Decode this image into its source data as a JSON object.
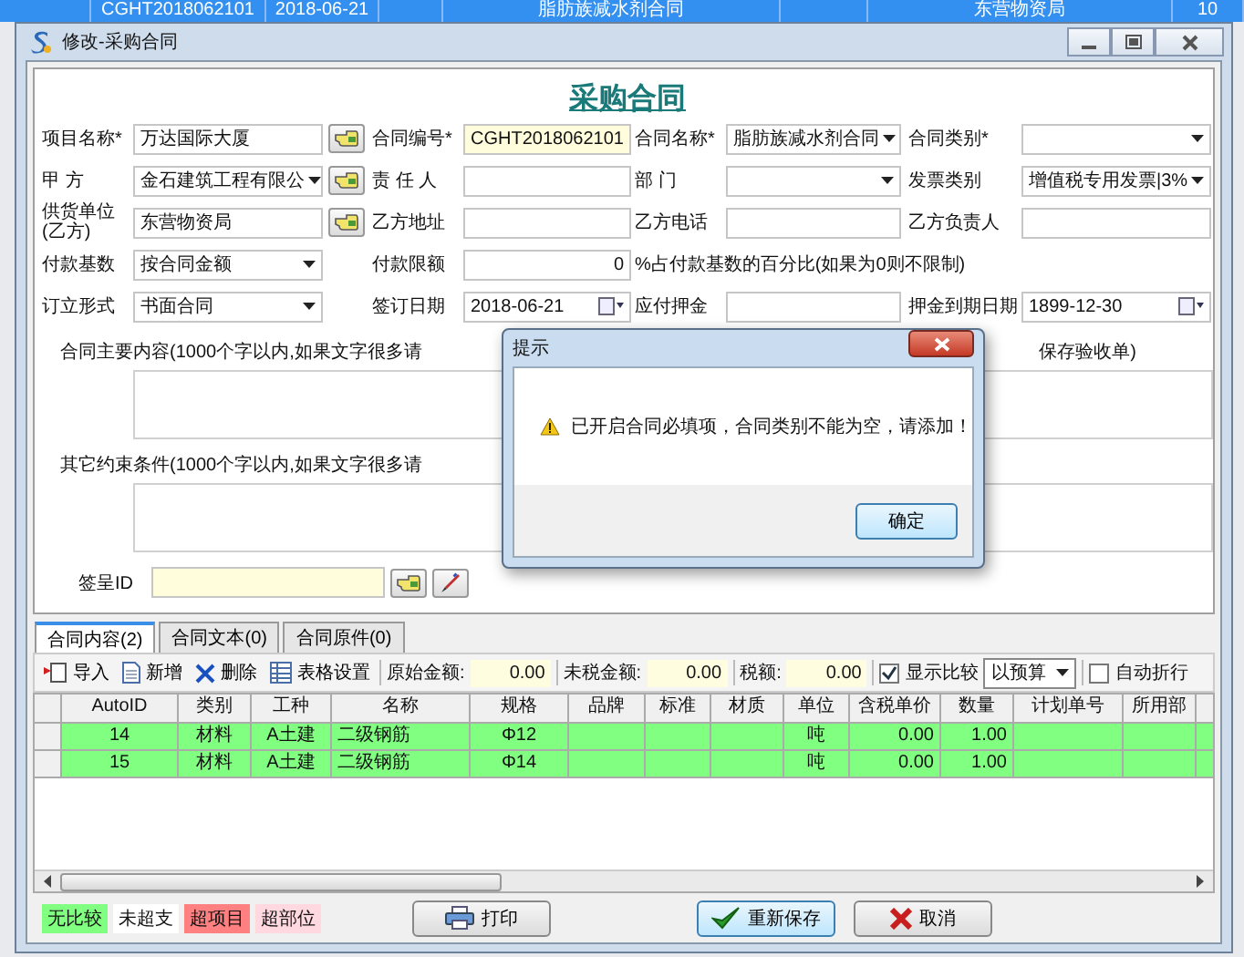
{
  "background_row": {
    "cells": [
      "CGHT2018062101",
      "2018-06-21",
      "脂肪族减水剂合同",
      "东营物资局",
      "10"
    ]
  },
  "window": {
    "title": "修改-采购合同"
  },
  "heading": "采购合同",
  "form": {
    "rows": [
      {
        "fields": [
          {
            "label": "项目名称*",
            "kind": "text",
            "value": "万达国际大厦",
            "readonly": false,
            "lookup": true
          },
          {
            "label": "合同编号*",
            "kind": "text",
            "value": "CGHT2018062101",
            "readonly": true,
            "lookup": false
          },
          {
            "label": "合同名称*",
            "kind": "select",
            "value": "脂肪族减水剂合同",
            "readonly": false,
            "lookup": false
          },
          {
            "label": "合同类别*",
            "kind": "select",
            "readonly": false,
            "lookup": false
          }
        ]
      },
      {
        "fields": [
          {
            "label": "甲 方",
            "kind": "select",
            "value": "金石建筑工程有限公",
            "readonly": false,
            "lookup": true
          },
          {
            "label": "责 任 人",
            "kind": "text",
            "readonly": false,
            "lookup": false
          },
          {
            "label": "部 门",
            "kind": "select",
            "readonly": false,
            "lookup": false
          },
          {
            "label": "发票类别",
            "kind": "select",
            "value": "增值税专用发票|3%",
            "readonly": false,
            "lookup": false
          }
        ]
      },
      {
        "fields": [
          {
            "label": "供货单位(乙方)",
            "kind": "text",
            "value": "东营物资局",
            "readonly": false,
            "lookup": true
          },
          {
            "label": "乙方地址",
            "kind": "text",
            "readonly": false,
            "lookup": false
          },
          {
            "label": "乙方电话",
            "kind": "text",
            "readonly": false,
            "lookup": false
          },
          {
            "label": "乙方负责人",
            "kind": "text",
            "readonly": false,
            "lookup": false
          }
        ]
      },
      {
        "fields": [
          {
            "label": "付款基数",
            "kind": "select",
            "value": "按合同金额",
            "readonly": false,
            "lookup": false
          },
          {
            "label": "付款限额",
            "kind": "number",
            "value": "0",
            "readonly": false,
            "lookup": false,
            "note": "%占付款基数的百分比(如果为0则不限制)"
          }
        ]
      },
      {
        "fields": [
          {
            "label": "订立形式",
            "kind": "select",
            "value": "书面合同",
            "readonly": false,
            "lookup": false
          },
          {
            "label": "签订日期",
            "kind": "date",
            "value": "2018-06-21",
            "readonly": false,
            "lookup": false
          },
          {
            "label": "应付押金",
            "kind": "text",
            "readonly": false,
            "lookup": false
          },
          {
            "label": "押金到期日期",
            "kind": "date",
            "value": "1899-12-30",
            "readonly": false,
            "lookup": false
          }
        ]
      }
    ]
  },
  "content_label": {
    "left": "合同主要内容(1000个字以内,如果文字很多请",
    "right": "保存验收单)"
  },
  "conditions_label": "其它约束条件(1000个字以内,如果文字很多请",
  "sign": {
    "label": "签呈ID",
    "readonly": true
  },
  "dialog": {
    "title": "提示",
    "message": "已开启合同必填项，合同类别不能为空，请添加！",
    "button": "确定"
  },
  "tabs": [
    {
      "label": "合同内容(2)",
      "selected": true
    },
    {
      "label": "合同文本(0)",
      "selected": false
    },
    {
      "label": "合同原件(0)",
      "selected": false
    }
  ],
  "toolbar": [
    {
      "kind": "button",
      "label": "导入"
    },
    {
      "kind": "button",
      "label": "新增"
    },
    {
      "kind": "button",
      "label": "删除"
    },
    {
      "kind": "button",
      "label": "表格设置"
    },
    {
      "kind": "amount",
      "label": "原始金额:",
      "value": "0.00"
    },
    {
      "kind": "amount",
      "label": "未税金额:",
      "value": "0.00"
    },
    {
      "kind": "amount",
      "label": "税额:",
      "value": "0.00"
    },
    {
      "kind": "checkbox",
      "label": "显示比较",
      "checked": true
    },
    {
      "kind": "select",
      "value": "以预算"
    },
    {
      "kind": "checkbox",
      "label": "自动折行",
      "checked": false
    }
  ],
  "grid": {
    "columns": [
      "AutoID",
      "类别",
      "工种",
      "名称",
      "规格",
      "品牌",
      "标准",
      "材质",
      "单位",
      "含税单价",
      "数量",
      "计划单号",
      "所用部"
    ],
    "rows": [
      {
        "cells": [
          "14",
          "材料",
          "A土建",
          "二级钢筋",
          "Φ12",
          null,
          null,
          null,
          "吨",
          "0.00",
          "1.00",
          null,
          null
        ],
        "color": "#80ff80"
      },
      {
        "cells": [
          "15",
          "材料",
          "A土建",
          "二级钢筋",
          "Φ14",
          null,
          null,
          null,
          "吨",
          "0.00",
          "1.00",
          null,
          null
        ],
        "color": "#80ff80"
      }
    ]
  },
  "legend": [
    {
      "label": "无比较",
      "color": "#80ff80"
    },
    {
      "label": "未超支",
      "color": "#ffffff"
    },
    {
      "label": "超项目",
      "color": "#ff8080"
    },
    {
      "label": "超部位",
      "color": "#ffd8e0"
    }
  ],
  "buttons": [
    {
      "label": "打印",
      "default": false
    },
    {
      "label": "重新保存",
      "default": true
    },
    {
      "label": "取消",
      "default": false
    }
  ]
}
